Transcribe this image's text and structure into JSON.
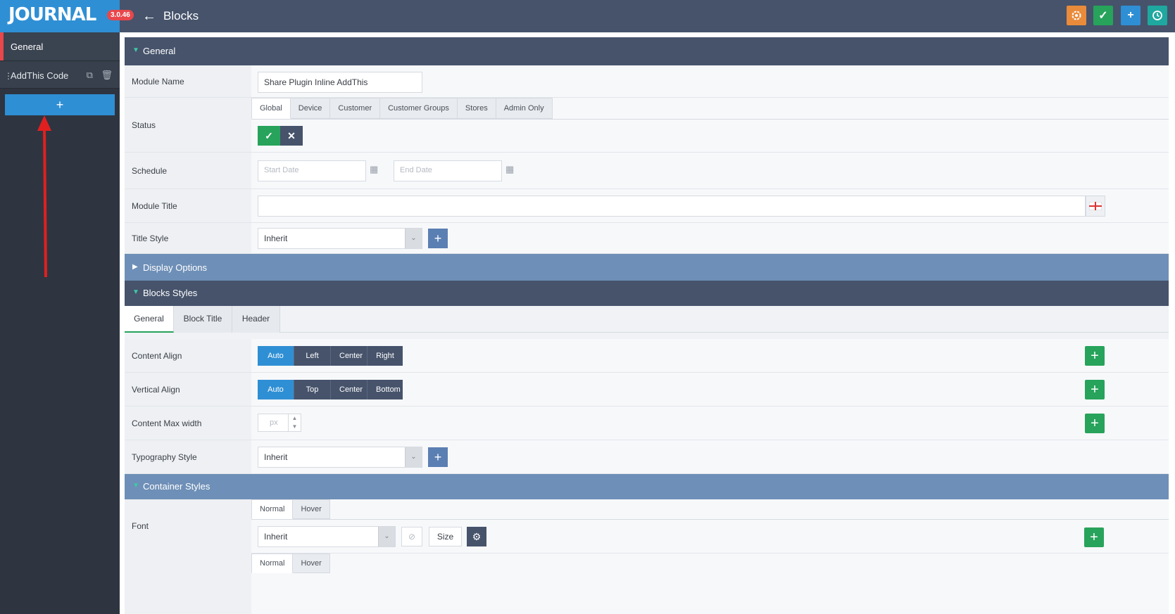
{
  "app": {
    "logo": "JOURNAL",
    "version": "3.0.46"
  },
  "header": {
    "back_icon": "arrow-left-icon",
    "title": "Blocks"
  },
  "toolbar": {
    "icons": [
      "settings-icon",
      "check-icon",
      "plus-icon",
      "history-icon"
    ],
    "colors": {
      "settings": "#e98b3a",
      "save": "#27a35b",
      "add": "#2f8fd4",
      "history": "#1fa89f"
    }
  },
  "sidebar": {
    "general_label": "General",
    "item_label": "AddThis Code",
    "add_label": "+"
  },
  "general_section": {
    "title": "General",
    "module_name": {
      "label": "Module Name",
      "value": "Share Plugin Inline AddThis"
    },
    "status": {
      "label": "Status",
      "tabs": [
        "Global",
        "Device",
        "Customer",
        "Customer Groups",
        "Stores",
        "Admin Only"
      ],
      "active_tab": "Global",
      "value": "on"
    },
    "schedule": {
      "label": "Schedule",
      "start_placeholder": "Start Date",
      "end_placeholder": "End Date"
    },
    "module_title": {
      "label": "Module Title",
      "value": ""
    },
    "title_style": {
      "label": "Title Style",
      "value": "Inherit"
    }
  },
  "display_options": {
    "title": "Display Options"
  },
  "blocks_styles": {
    "title": "Blocks Styles",
    "tabs": [
      "General",
      "Block Title",
      "Header"
    ],
    "active_tab": "General",
    "content_align": {
      "label": "Content Align",
      "options": [
        "Auto",
        "Left",
        "Center",
        "Right"
      ],
      "selected": "Auto"
    },
    "vertical_align": {
      "label": "Vertical Align",
      "options": [
        "Auto",
        "Top",
        "Center",
        "Bottom"
      ],
      "selected": "Auto"
    },
    "content_max_width": {
      "label": "Content Max width",
      "placeholder": "px"
    },
    "typography_style": {
      "label": "Typography Style",
      "value": "Inherit"
    }
  },
  "container_styles": {
    "title": "Container Styles",
    "font": {
      "label": "Font",
      "state_tabs": [
        "Normal",
        "Hover"
      ],
      "active_state": "Normal",
      "value": "Inherit",
      "size_label": "Size"
    }
  }
}
